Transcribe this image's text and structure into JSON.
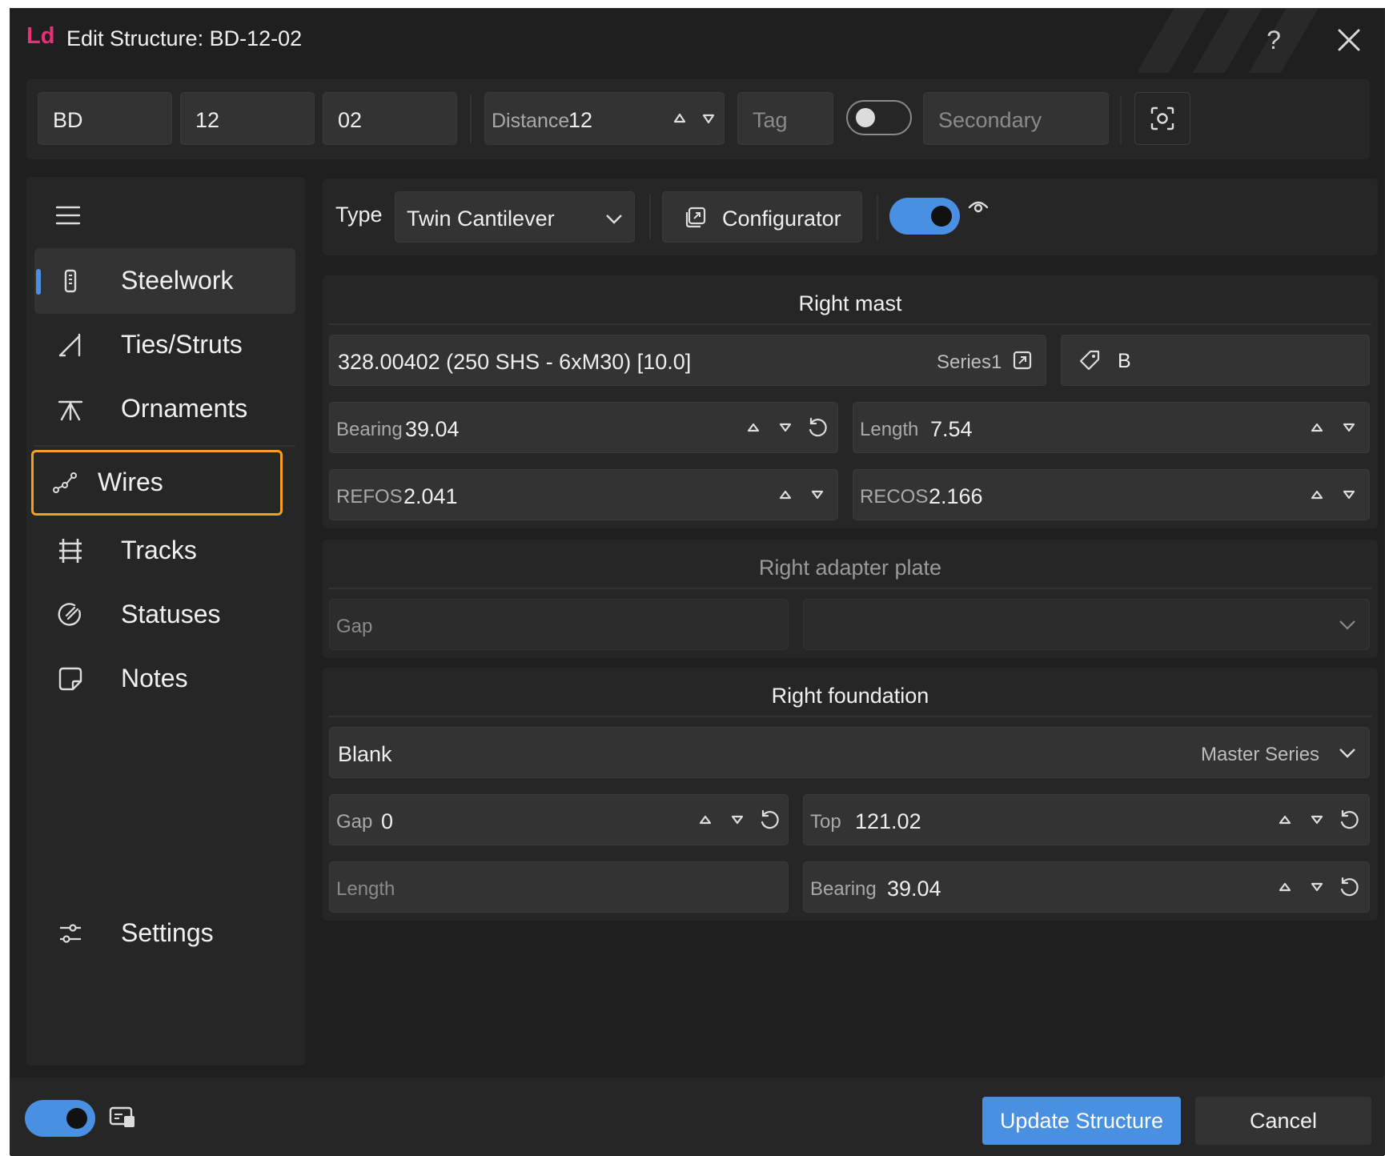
{
  "titlebar": {
    "logo": "Ld",
    "title": "Edit Structure: BD-12-02",
    "help_label": "?"
  },
  "header": {
    "code1": "BD",
    "code2": "12",
    "code3": "02",
    "distance_label": "Distance",
    "distance_value": "12",
    "tag_placeholder": "Tag",
    "secondary_toggle_on": false,
    "secondary_placeholder": "Secondary"
  },
  "sidebar": {
    "items": [
      {
        "label": "Steelwork",
        "icon": "steelwork-icon",
        "active": true
      },
      {
        "label": "Ties/Struts",
        "icon": "ties-struts-icon"
      },
      {
        "label": "Ornaments",
        "icon": "ornaments-icon"
      },
      {
        "label": "Wires",
        "icon": "wires-icon",
        "highlighted": true
      },
      {
        "label": "Tracks",
        "icon": "tracks-icon"
      },
      {
        "label": "Statuses",
        "icon": "statuses-icon"
      },
      {
        "label": "Notes",
        "icon": "notes-icon"
      },
      {
        "label": "Settings",
        "icon": "settings-icon"
      }
    ]
  },
  "typebar": {
    "type_label": "Type",
    "type_value": "Twin Cantilever",
    "configurator_label": "Configurator",
    "visibility_toggle_on": true
  },
  "right_mast": {
    "title": "Right mast",
    "part_value": "328.00402 (250 SHS - 6xM30) [10.0]",
    "series": "Series1",
    "tag_value": "B",
    "bearing_label": "Bearing",
    "bearing_value": "39.04",
    "length_label": "Length",
    "length_value": "7.54",
    "refos_label": "REFOS",
    "refos_value": "2.041",
    "recos_label": "RECOS",
    "recos_value": "2.166"
  },
  "right_adapter_plate": {
    "title": "Right adapter plate",
    "gap_placeholder": "Gap"
  },
  "right_foundation": {
    "title": "Right foundation",
    "type_value": "Blank",
    "series": "Master Series",
    "gap_label": "Gap",
    "gap_value": "0",
    "top_label": "Top",
    "top_value": "121.02",
    "length_placeholder": "Length",
    "bearing_label": "Bearing",
    "bearing_value": "39.04"
  },
  "footer": {
    "toggle_on": true,
    "update_label": "Update Structure",
    "cancel_label": "Cancel"
  },
  "colors": {
    "accent": "#4a90e2",
    "highlight": "#f2a01d",
    "logo": "#e8307a",
    "background": "#1f1f1f",
    "panel": "#262626",
    "field": "#333333"
  }
}
